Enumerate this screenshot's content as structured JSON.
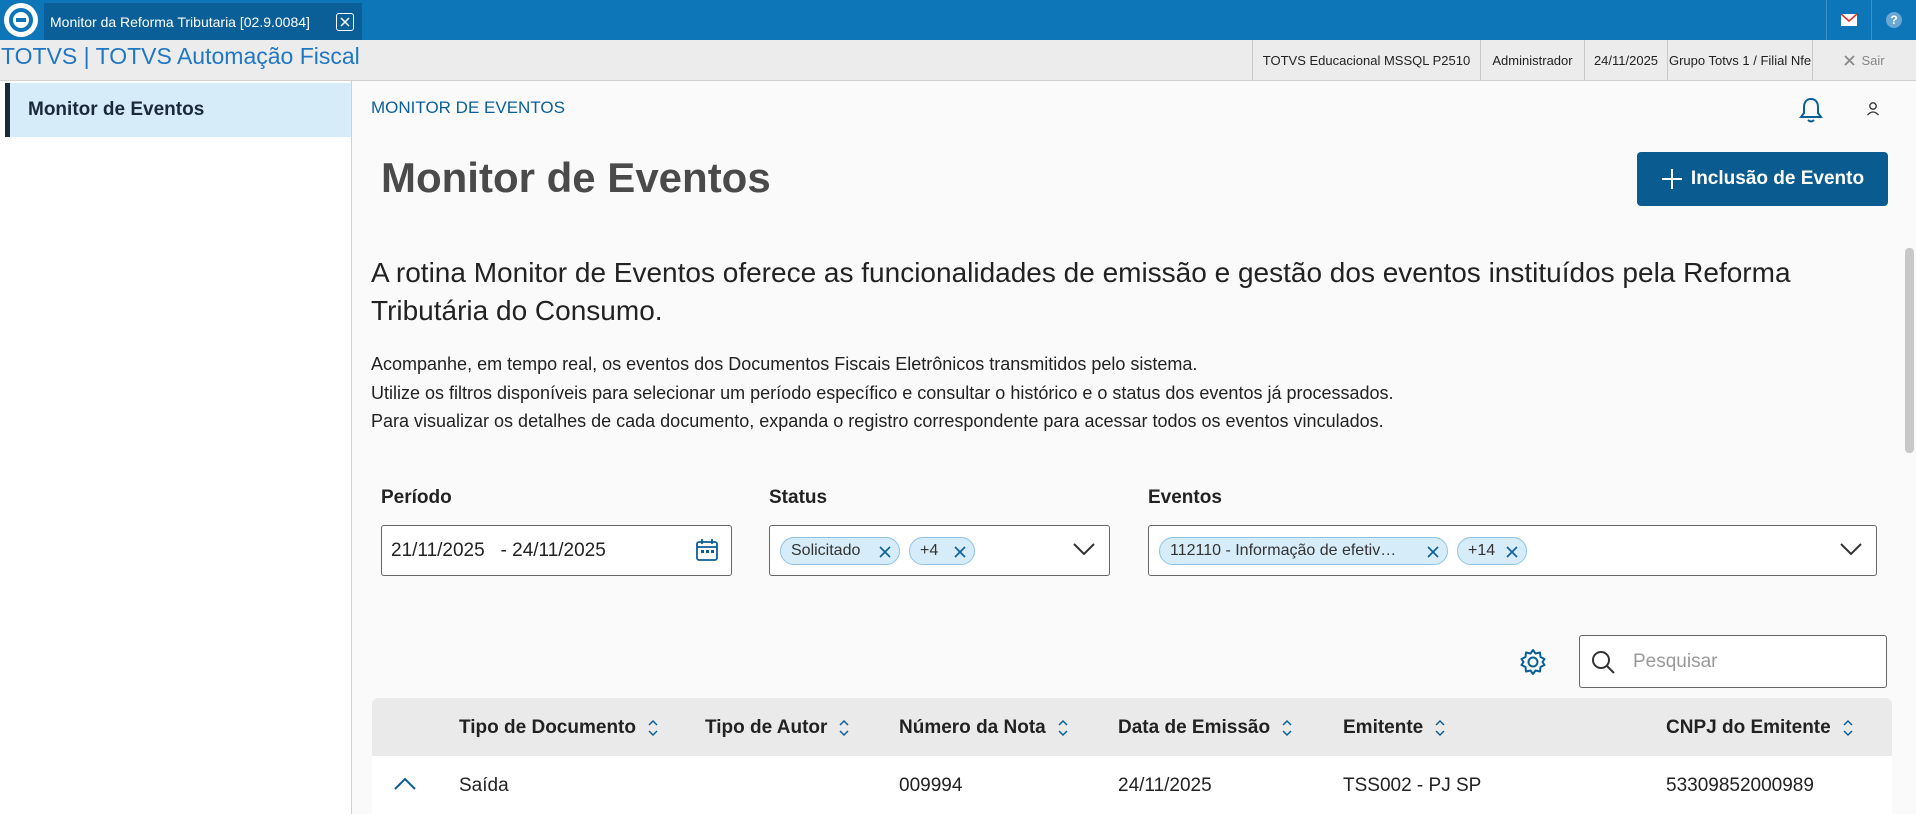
{
  "window": {
    "tab_title": "Monitor da Reforma Tributaria [02.9.0084]"
  },
  "menubar": {
    "app_title": "TOTVS | TOTVS Automação Fiscal",
    "environment": "TOTVS Educacional MSSQL P2510",
    "user": "Administrador",
    "date": "24/11/2025",
    "company": "Grupo Totvs 1 / Filial Nfe",
    "exit_label": "Sair"
  },
  "sidebar": {
    "items": [
      {
        "label": "Monitor de Eventos"
      }
    ]
  },
  "page": {
    "breadcrumb": "MONITOR DE EVENTOS",
    "title": "Monitor de Eventos",
    "add_button_label": "Inclusão de Evento",
    "lead": "A rotina Monitor de Eventos oferece as funcionalidades de emissão e gestão dos eventos instituídos pela Reforma Tributária do Consumo.",
    "paragraphs": [
      "Acompanhe, em tempo real, os eventos dos Documentos Fiscais Eletrônicos transmitidos pelo sistema.",
      "Utilize os filtros disponíveis para selecionar um período específico e consultar o histórico e o status dos eventos já processados.",
      "Para visualizar os detalhes de cada documento, expanda o registro correspondente para acessar todos os eventos vinculados."
    ]
  },
  "filters": {
    "periodo": {
      "label": "Período",
      "value": "21/11/2025   - 24/11/2025"
    },
    "status": {
      "label": "Status",
      "chips": [
        "Solicitado",
        "+4"
      ]
    },
    "eventos": {
      "label": "Eventos",
      "chips": [
        "112110 - Informação de efetiv…",
        "+14"
      ]
    }
  },
  "search": {
    "placeholder": "Pesquisar"
  },
  "table": {
    "columns": [
      "Tipo de Documento",
      "Tipo de Autor",
      "Número da Nota",
      "Data de Emissão",
      "Emitente",
      "CNPJ do Emitente"
    ],
    "rows": [
      {
        "tipo_documento": "Saída",
        "tipo_autor": "",
        "numero_nota": "009994",
        "data_emissao": "24/11/2025",
        "emitente": "TSS002 - PJ SP",
        "cnpj": "53309852000989"
      }
    ]
  },
  "colors": {
    "topbar": "#0c76b8",
    "primary": "#0a5b8f",
    "sidebar_active": "#d6ecf9"
  },
  "icons": [
    "totvs-logo-icon",
    "close-icon",
    "mail-icon",
    "help-icon",
    "bell-icon",
    "user-icon",
    "plus-icon",
    "calendar-icon",
    "chevron-down-icon",
    "settings-icon",
    "search-icon",
    "sort-icon",
    "chevron-up-icon"
  ]
}
